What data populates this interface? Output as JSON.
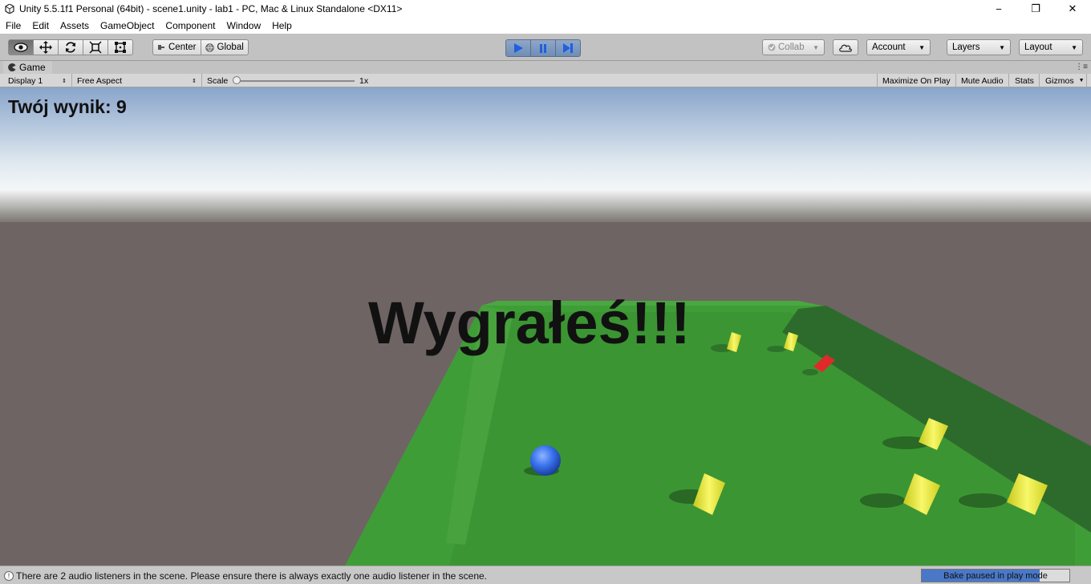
{
  "window": {
    "title": "Unity 5.5.1f1 Personal (64bit) - scene1.unity - lab1 - PC, Mac & Linux Standalone <DX11>",
    "minimize": "−",
    "maximize": "❐",
    "close": "✕"
  },
  "menu": [
    "File",
    "Edit",
    "Assets",
    "GameObject",
    "Component",
    "Window",
    "Help"
  ],
  "toolbar": {
    "tools": [
      "view-hand-icon",
      "move-icon",
      "rotate-icon",
      "scale-icon",
      "rect-icon"
    ],
    "active_tool": "view-hand-icon",
    "pivot_label": "Center",
    "space_label": "Global",
    "collab_label": "Collab",
    "account_label": "Account",
    "layers_label": "Layers",
    "layout_label": "Layout",
    "play_state": "playing"
  },
  "game_tab": {
    "label": "Game",
    "display": "Display 1",
    "aspect": "Free Aspect",
    "scale_label": "Scale",
    "scale_value": "1x",
    "maximize_on_play": "Maximize On Play",
    "mute_audio": "Mute Audio",
    "stats": "Stats",
    "gizmos": "Gizmos"
  },
  "game": {
    "score_text": "Twój wynik: 9",
    "win_text": "Wygrałeś!!!",
    "colors": {
      "sky_top": "#8aa6cc",
      "horizon": "#f2f6f8",
      "ground": "#6e6463",
      "board": "#3c9a35",
      "wall": "#2d6b2c",
      "player": "#2f6bf0",
      "pickup": "#f0f03a",
      "red_pickup": "#e02a2a"
    }
  },
  "status": {
    "message": "There are 2 audio listeners in the scene. Please ensure there is always exactly one audio listener in the scene.",
    "bake_text": "Bake paused in play mode",
    "bake_progress": 0.8
  }
}
